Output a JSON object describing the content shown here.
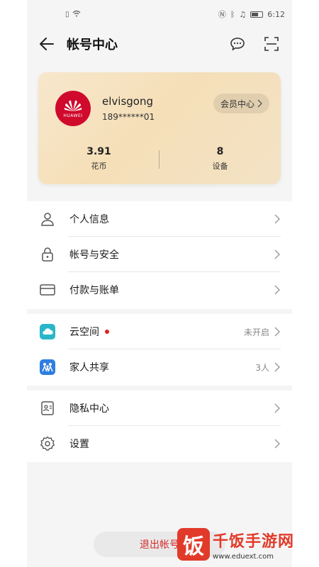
{
  "status_bar": {
    "time": "6:12"
  },
  "header": {
    "title": "帐号中心"
  },
  "card": {
    "username": "elvisgong",
    "phone": "189******01",
    "member_center_label": "会员中心",
    "avatar_logo_text": "HUAWEI",
    "stats": [
      {
        "value": "3.91",
        "label": "花币"
      },
      {
        "value": "8",
        "label": "设备"
      }
    ]
  },
  "groups": [
    {
      "items": [
        {
          "icon": "person-icon",
          "label": "个人信息",
          "value": ""
        },
        {
          "icon": "lock-icon",
          "label": "帐号与安全",
          "value": ""
        },
        {
          "icon": "card-icon",
          "label": "付款与账单",
          "value": ""
        }
      ]
    },
    {
      "items": [
        {
          "icon": "cloud-icon",
          "label": "云空间",
          "value": "未开启",
          "dot": true
        },
        {
          "icon": "family-icon",
          "label": "家人共享",
          "value": "3人"
        }
      ]
    },
    {
      "items": [
        {
          "icon": "privacy-icon",
          "label": "隐私中心",
          "value": ""
        },
        {
          "icon": "settings-icon",
          "label": "设置",
          "value": ""
        }
      ]
    }
  ],
  "logout_label": "退出帐号",
  "watermark": {
    "seal": "饭",
    "name": "千饭手游网",
    "url": "www.eduext.com"
  },
  "colors": {
    "accent_red": "#cf0a2c",
    "logout_red": "#d32a2a",
    "cloud_teal": "#29b6c8",
    "family_blue": "#2f7de1"
  }
}
